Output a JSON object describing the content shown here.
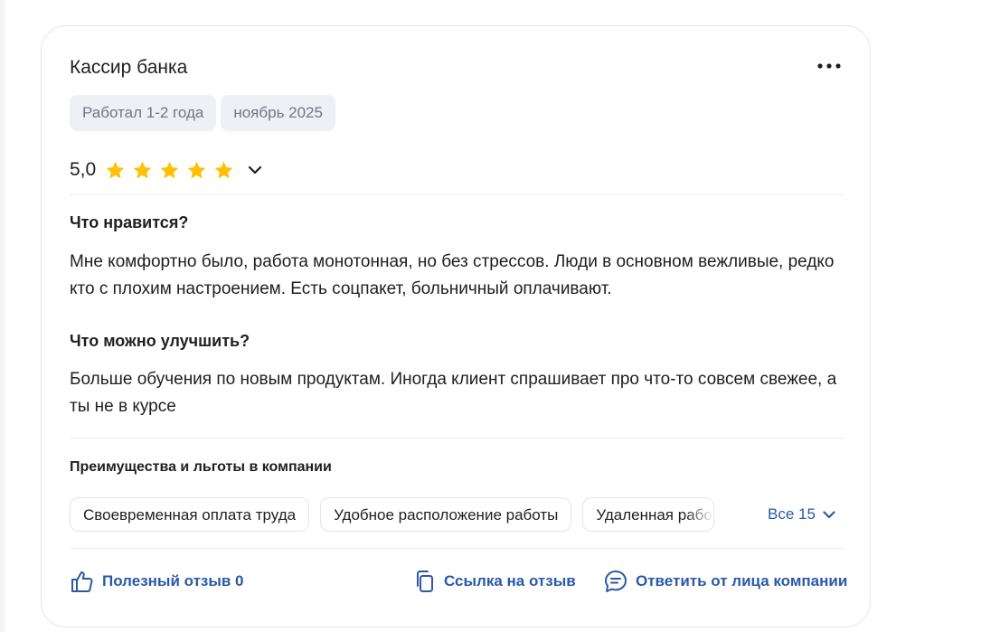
{
  "review": {
    "title": "Кассир банка",
    "tags": [
      "Работал 1-2 года",
      "ноябрь 2025"
    ],
    "rating": "5,0",
    "rating_stars": 5,
    "likes_title": "Что нравится?",
    "likes_text": "Мне комфортно было, работа монотонная, но без стрессов. Люди в основном вежливые, редко кто с плохим настроением. Есть соцпакет, больничный оплачивают.",
    "improve_title": "Что можно улучшить?",
    "improve_text": "Больше обучения по новым продуктам. Иногда клиент спрашивает про что-то совсем свежее, а ты не в курсе",
    "benefits_title": "Преимущества и льготы в компании",
    "benefits": [
      "Своевременная оплата труда",
      "Удобное расположение работы",
      "Удаленная работа"
    ],
    "benefits_all": "Все 15",
    "actions": {
      "useful": "Полезный отзыв 0",
      "link": "Ссылка на отзыв",
      "reply": "Ответить от лица компании"
    }
  },
  "icons": {
    "more": "more-dots-icon",
    "star": "star-icon",
    "chevron": "chevron-down-icon",
    "thumb": "thumb-up-icon",
    "copy": "copy-link-icon",
    "chat": "chat-bubble-icon"
  },
  "colors": {
    "accent": "#2b59a8",
    "star": "#ffc107",
    "chip_bg": "#eef0f5",
    "chip_text": "#6f7686"
  }
}
